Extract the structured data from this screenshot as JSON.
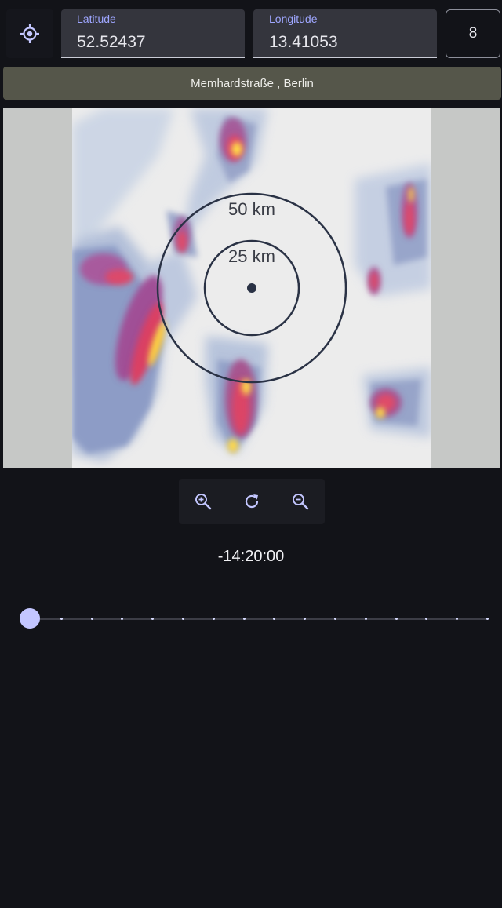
{
  "header": {
    "locate_icon": "gps-target-icon",
    "latitude": {
      "label": "Latitude",
      "value": "52.52437"
    },
    "longitude": {
      "label": "Longitude",
      "value": "13.41053"
    },
    "zoom_value": "8"
  },
  "address": "Memhardstraße , Berlin",
  "map": {
    "ring_outer_label": "50 km",
    "ring_inner_label": "25 km"
  },
  "controls": {
    "zoom_in_icon": "zoom-in-icon",
    "refresh_icon": "refresh-icon",
    "zoom_out_icon": "zoom-out-icon"
  },
  "timeline": {
    "time_label": "-14:20:00",
    "position": 0,
    "tick_count": 16
  },
  "colors": {
    "background": "#121318",
    "accent": "#9ea6ff",
    "thumb": "#c3c6ff",
    "address_bar": "#55564a"
  }
}
